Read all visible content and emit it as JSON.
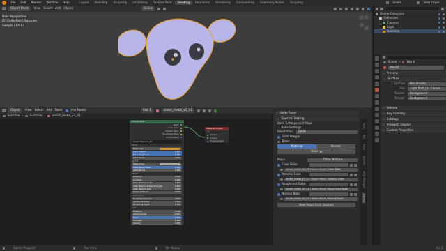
{
  "topbar": {
    "menus": [
      "File",
      "Edit",
      "Render",
      "Window",
      "Help"
    ],
    "workspaces": [
      "Layout",
      "Modeling",
      "Sculpting",
      "UV Editing",
      "Texture Paint",
      "Shading",
      "Animation",
      "Rendering",
      "Compositing",
      "Geometry Nodes",
      "Scripting"
    ],
    "active_workspace": "Shading",
    "scene_label": "Scene",
    "viewlayer_label": "View Layer"
  },
  "viewport": {
    "mode": "Object Mode",
    "menus": [
      "View",
      "Select",
      "Add",
      "Object"
    ],
    "orientation": "Global",
    "info_line1": "User Perspective",
    "info_line2": "(1) Collection | Suzanne",
    "info_line3": "Sample 40/512"
  },
  "outliner": {
    "items": [
      {
        "label": "Scene Collection",
        "indent": 0,
        "selected": false
      },
      {
        "label": "Collection",
        "indent": 1,
        "selected": false
      },
      {
        "label": "Camera",
        "indent": 2,
        "selected": false
      },
      {
        "label": "Light",
        "indent": 2,
        "selected": false
      },
      {
        "label": "Suzanne",
        "indent": 2,
        "selected": true
      }
    ]
  },
  "properties": {
    "breadcrumb_scene": "Scene",
    "breadcrumb_world": "World",
    "world_name": "World",
    "sections": {
      "preview": "Preview",
      "surface": "Surface",
      "volume": "Volume",
      "ray_visibility": "Ray Visibility",
      "settings": "Settings",
      "viewport_display": "Viewport Display",
      "custom_properties": "Custom Properties"
    },
    "surface_label": "Surface",
    "surface_value": "Mix Shader",
    "fac_label": "Fac",
    "fac_value": "Light Path | Is Camer...",
    "shader1_label": "Shader",
    "shader1_value": "Background",
    "shader2_label": "Shader",
    "shader2_value": "Background"
  },
  "node_editor": {
    "object_label": "Object",
    "menus": [
      "View",
      "Select",
      "Add",
      "Node"
    ],
    "use_nodes_label": "Use Nodes",
    "slot": "Slot 1",
    "material": "smart_metal_v2_01",
    "breadcrumb": [
      "Suzanne",
      "Suzanne",
      "smart_metal_v2_01"
    ],
    "group_node": {
      "title": "Smart Metal",
      "outputs": [
        "BSDF",
        "Color Bake",
        "Metallic Bake",
        "Roughness Bake",
        "Normal Bake"
      ],
      "group_name": "Smart Metal v2_01",
      "rows": [
        {
          "label": "PAINT",
          "value": ""
        },
        {
          "label": "Base Color",
          "value": "",
          "type": "color",
          "color": "#d79a2b"
        },
        {
          "label": "Paint Metallic",
          "value": "0.000",
          "type": "blue"
        },
        {
          "label": "Paint Roughness",
          "value": "0.350",
          "type": "blue"
        },
        {
          "label": "Paint Bump",
          "value": "0.500",
          "type": "num"
        },
        {
          "label": "METAL",
          "value": ""
        },
        {
          "label": "Metal Color",
          "value": "",
          "type": "color",
          "color": "#a8a8a8"
        },
        {
          "label": "Metal Roughness",
          "value": "0.300",
          "type": "blue"
        },
        {
          "label": "Metal Bump",
          "value": "0.200",
          "type": "num"
        },
        {
          "label": "EDGES",
          "value": ""
        },
        {
          "label": "Distance",
          "value": "0.050",
          "type": "num"
        },
        {
          "label": "Contrast",
          "value": "0.500",
          "type": "num"
        },
        {
          "label": "Wear Texture Scale",
          "value": "3.000",
          "type": "num"
        },
        {
          "label": "Wear Texture Detail Strength",
          "value": "0.500",
          "type": "num"
        },
        {
          "label": "Wear Texture Bias",
          "value": "0.500",
          "type": "num"
        },
        {
          "label": "Smart Softness",
          "value": "0.050",
          "type": "num"
        },
        {
          "label": "SCRATCHES",
          "value": ""
        },
        {
          "label": "Scratches Amount",
          "value": "0.300",
          "type": "num"
        },
        {
          "label": "Scratches Scale",
          "value": "3.000",
          "type": "num"
        },
        {
          "label": "Scratches Depth",
          "value": "0.100",
          "type": "num"
        },
        {
          "label": "DIRT",
          "value": ""
        },
        {
          "label": "Distance",
          "value": "0.100",
          "type": "num"
        },
        {
          "label": "Texture Scale",
          "value": "0.050",
          "type": "num"
        },
        {
          "label": "Detail",
          "value": "0.500",
          "type": "blue"
        },
        {
          "label": "Contrast",
          "value": "0.500",
          "type": "num"
        },
        {
          "label": "Opacity",
          "value": "1.000",
          "type": "num"
        }
      ]
    },
    "output_node": {
      "title": "Material Output",
      "target": "All",
      "inputs": [
        "Surface",
        "Volume",
        "Displacement"
      ]
    }
  },
  "sidebar": {
    "panel_node": "Node Panel",
    "panel_baking": "Spectral Baking",
    "subheading": "Bake Settings and Maps",
    "bake_settings": "Bake Settings",
    "resolution_label": "Resolution:",
    "resolution_value": "2048",
    "auto_margin": "Auto Margin",
    "bake_label": "Bake:",
    "tab_material": "Material",
    "tab_decals": "Decals",
    "bake_button": "Bake",
    "maps_label": "Maps",
    "clear_button": "Clear Texture",
    "maps": [
      {
        "name": "Color Bake",
        "file": "smart_metal_v2_01 / Smart Metal / Color Bake"
      },
      {
        "name": "Metallic Bake",
        "file": "smart_metal_v2_01 / Smart Metal / Metallic Bake"
      },
      {
        "name": "Roughness Bake",
        "file": "smart_metal_v2_01 / Smart Metal / Roughness Bake"
      },
      {
        "name": "Normal Bake",
        "file": "smart_metal_v2_01 / Smart Metal / Normal Bake"
      }
    ],
    "new_maps_button": "New Maps from Sockets",
    "tabs": [
      "Node",
      "Tool",
      "View",
      "Options",
      "Node Wrangler",
      "Baking"
    ],
    "active_tab": "Baking"
  },
  "status": {
    "select": "Select Program",
    "pan": "Pan View",
    "menu": "Nd Nodes",
    "version": "4.0.2"
  },
  "colors": {
    "accent": "#4772b3",
    "active_ws": "#474747",
    "suzanne": "#b8b6e8",
    "outline": "#e8a33d"
  }
}
